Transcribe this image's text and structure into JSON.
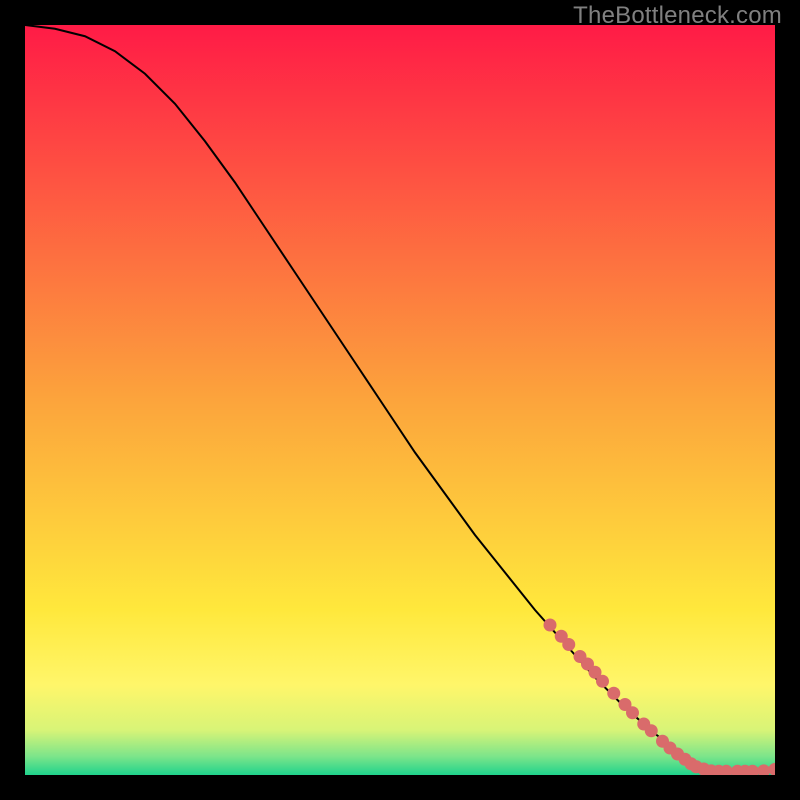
{
  "watermark": "TheBottleneck.com",
  "chart_data": {
    "type": "line",
    "title": "",
    "xlabel": "",
    "ylabel": "",
    "xlim": [
      0,
      100
    ],
    "ylim": [
      0,
      100
    ],
    "grid": false,
    "legend": false,
    "background_gradient": {
      "stops": [
        {
          "offset": 0.0,
          "color": "#ff1b46"
        },
        {
          "offset": 0.5,
          "color": "#fca43c"
        },
        {
          "offset": 0.78,
          "color": "#ffe83c"
        },
        {
          "offset": 0.88,
          "color": "#fff66a"
        },
        {
          "offset": 0.94,
          "color": "#d8f477"
        },
        {
          "offset": 0.975,
          "color": "#7de58a"
        },
        {
          "offset": 1.0,
          "color": "#20d38c"
        }
      ]
    },
    "series": [
      {
        "name": "curve",
        "color": "#000000",
        "width": 2,
        "x": [
          0,
          4,
          8,
          12,
          16,
          20,
          24,
          28,
          32,
          36,
          40,
          44,
          48,
          52,
          56,
          60,
          64,
          68,
          72,
          76,
          80,
          84,
          86,
          88,
          90,
          92,
          94,
          96,
          98,
          100
        ],
        "y": [
          100,
          99.5,
          98.5,
          96.5,
          93.5,
          89.5,
          84.5,
          79.0,
          73.0,
          67.0,
          61.0,
          55.0,
          49.0,
          43.0,
          37.5,
          32.0,
          27.0,
          22.0,
          17.5,
          13.0,
          9.0,
          5.5,
          4.0,
          2.5,
          1.2,
          0.6,
          0.5,
          0.5,
          0.5,
          0.7
        ]
      }
    ],
    "markers": [
      {
        "x": 70.0,
        "y": 20.0
      },
      {
        "x": 71.5,
        "y": 18.5
      },
      {
        "x": 72.5,
        "y": 17.4
      },
      {
        "x": 74.0,
        "y": 15.8
      },
      {
        "x": 75.0,
        "y": 14.8
      },
      {
        "x": 76.0,
        "y": 13.7
      },
      {
        "x": 77.0,
        "y": 12.5
      },
      {
        "x": 78.5,
        "y": 10.9
      },
      {
        "x": 80.0,
        "y": 9.4
      },
      {
        "x": 81.0,
        "y": 8.3
      },
      {
        "x": 82.5,
        "y": 6.8
      },
      {
        "x": 83.5,
        "y": 5.9
      },
      {
        "x": 85.0,
        "y": 4.5
      },
      {
        "x": 86.0,
        "y": 3.6
      },
      {
        "x": 87.0,
        "y": 2.8
      },
      {
        "x": 88.0,
        "y": 2.1
      },
      {
        "x": 88.8,
        "y": 1.5
      },
      {
        "x": 89.5,
        "y": 1.1
      },
      {
        "x": 90.5,
        "y": 0.8
      },
      {
        "x": 91.5,
        "y": 0.55
      },
      {
        "x": 92.5,
        "y": 0.5
      },
      {
        "x": 93.5,
        "y": 0.5
      },
      {
        "x": 95.0,
        "y": 0.5
      },
      {
        "x": 96.0,
        "y": 0.5
      },
      {
        "x": 97.0,
        "y": 0.5
      },
      {
        "x": 98.5,
        "y": 0.55
      },
      {
        "x": 100.0,
        "y": 0.75
      }
    ],
    "marker_style": {
      "color": "#d96b6b",
      "radius": 6.5
    }
  }
}
